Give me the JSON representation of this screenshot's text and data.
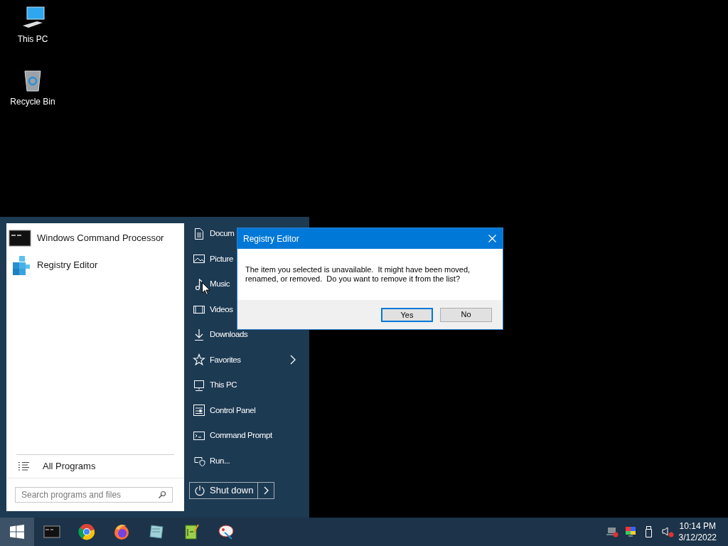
{
  "desktop_icons": [
    {
      "label": "This PC",
      "kind": "computer"
    },
    {
      "label": "Recycle Bin",
      "kind": "recycle"
    }
  ],
  "start_menu": {
    "programs": [
      {
        "label": "Windows Command Processor",
        "kind": "console"
      },
      {
        "label": "Registry Editor",
        "kind": "registry"
      }
    ],
    "all_programs": "All Programs",
    "search": {
      "placeholder": "Search programs and files"
    },
    "places": [
      {
        "label": "Docum",
        "kind": "document",
        "submenu": false
      },
      {
        "label": "Picture",
        "kind": "picture",
        "submenu": false
      },
      {
        "label": "Music",
        "kind": "music",
        "submenu": false
      },
      {
        "label": "Videos",
        "kind": "video",
        "submenu": false
      },
      {
        "label": "Downloads",
        "kind": "download",
        "submenu": false
      },
      {
        "label": "Favorites",
        "kind": "star",
        "submenu": true
      },
      {
        "label": "This PC",
        "kind": "computer",
        "submenu": false
      },
      {
        "label": "Control Panel",
        "kind": "control",
        "submenu": false
      },
      {
        "label": "Command Prompt",
        "kind": "command",
        "submenu": false
      },
      {
        "label": "Run...",
        "kind": "run",
        "submenu": false
      }
    ],
    "shutdown": {
      "label": "Shut down"
    }
  },
  "dialog": {
    "title": "Registry Editor",
    "message": "The item you selected is unavailable.  It might have been moved, renamed, or removed.  Do you want to remove it from the list?",
    "buttons": [
      {
        "label": "Yes",
        "default": true
      },
      {
        "label": "No",
        "default": false
      }
    ]
  },
  "taskbar": {
    "start_selected": true,
    "pinned": [
      {
        "kind": "console"
      },
      {
        "kind": "ring"
      },
      {
        "kind": "flame"
      },
      {
        "kind": "notepad"
      },
      {
        "kind": "editor"
      },
      {
        "kind": "paint"
      }
    ],
    "tray": [
      {
        "kind": "network"
      },
      {
        "kind": "display"
      },
      {
        "kind": "usb"
      },
      {
        "kind": "speaker"
      }
    ],
    "clock": {
      "time": "10:14 PM",
      "date": "3/12/2022"
    }
  }
}
